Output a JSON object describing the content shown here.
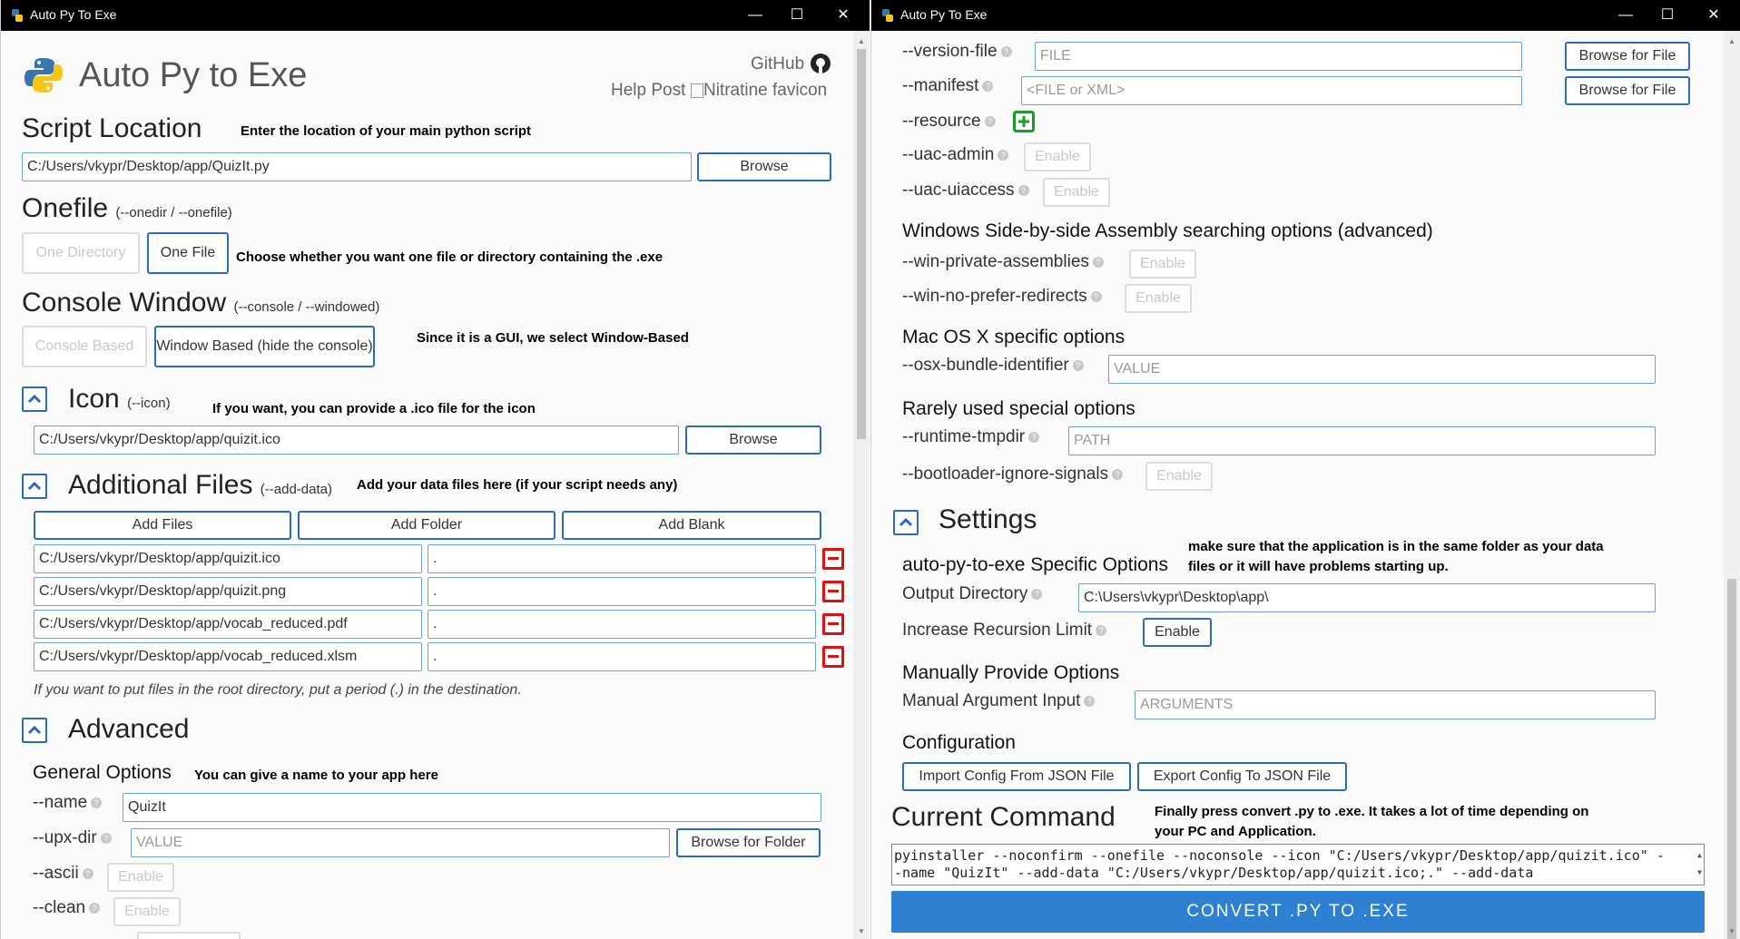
{
  "left_window": {
    "title": "Auto Py To Exe",
    "controls": {
      "minimize": "—",
      "maximize": "☐",
      "close": "✕"
    },
    "app_title": "Auto Py to Exe",
    "links": {
      "github": "GitHub",
      "help_post": "Help Post",
      "favicon_alt": "Nitratine favicon"
    },
    "script_location": {
      "heading": "Script Location",
      "annotation": "Enter the location of your main python script",
      "value": "C:/Users/vkypr/Desktop/app/QuizIt.py",
      "browse_label": "Browse"
    },
    "onefile": {
      "heading": "Onefile",
      "sub": "(--onedir / --onefile)",
      "one_directory": "One Directory",
      "one_file": "One File",
      "annotation": "Choose whether you want one file or directory containing the .exe"
    },
    "console": {
      "heading": "Console Window",
      "sub": "(--console / --windowed)",
      "console_based": "Console Based",
      "window_based": "Window Based (hide the console)",
      "annotation": "Since it is a GUI, we select Window-Based"
    },
    "icon": {
      "heading": "Icon",
      "sub": "(--icon)",
      "annotation": "If you want, you can provide a .ico file for the icon",
      "value": "C:/Users/vkypr/Desktop/app/quizit.ico",
      "browse_label": "Browse"
    },
    "additional_files": {
      "heading": "Additional Files",
      "sub": "(--add-data)",
      "annotation": "Add your data files here (if your script needs any)",
      "add_files": "Add Files",
      "add_folder": "Add Folder",
      "add_blank": "Add Blank",
      "rows": [
        {
          "src": "C:/Users/vkypr/Desktop/app/quizit.ico",
          "dest": "."
        },
        {
          "src": "C:/Users/vkypr/Desktop/app/quizit.png",
          "dest": "."
        },
        {
          "src": "C:/Users/vkypr/Desktop/app/vocab_reduced.pdf",
          "dest": "."
        },
        {
          "src": "C:/Users/vkypr/Desktop/app/vocab_reduced.xlsm",
          "dest": "."
        }
      ],
      "note": "If you want to put files in the root directory, put a period (.) in the destination."
    },
    "advanced": {
      "heading": "Advanced",
      "general_options": "General Options",
      "annotation": "You can give a name to your app here",
      "name_label": "--name",
      "name_value": "QuizIt",
      "upx_label": "--upx-dir",
      "upx_placeholder": "VALUE",
      "browse_folder": "Browse for Folder",
      "ascii_label": "--ascii",
      "clean_label": "--clean",
      "enable": "Enable"
    }
  },
  "right_window": {
    "title": "Auto Py To Exe",
    "controls": {
      "minimize": "—",
      "maximize": "☐",
      "close": "✕"
    },
    "version_file": {
      "label": "--version-file",
      "placeholder": "FILE",
      "browse": "Browse for File"
    },
    "manifest": {
      "label": "--manifest",
      "placeholder": "<FILE or XML>",
      "browse": "Browse for File"
    },
    "resource_label": "--resource",
    "uac_admin_label": "--uac-admin",
    "uac_uiaccess_label": "--uac-uiaccess",
    "enable": "Enable",
    "sxs_heading": "Windows Side-by-side Assembly searching options (advanced)",
    "win_private_label": "--win-private-assemblies",
    "win_no_prefer_label": "--win-no-prefer-redirects",
    "mac_heading": "Mac OS X specific options",
    "osx_label": "--osx-bundle-identifier",
    "osx_placeholder": "VALUE",
    "rare_heading": "Rarely used special options",
    "runtime_label": "--runtime-tmpdir",
    "runtime_placeholder": "PATH",
    "bootloader_label": "--bootloader-ignore-signals",
    "settings": {
      "heading": "Settings",
      "specific": "auto-py-to-exe Specific Options",
      "annotation": "make sure that the application is in the same folder as your data files or it will have problems starting up.",
      "output_label": "Output Directory",
      "output_value": "C:\\Users\\vkypr\\Desktop\\app\\",
      "recursion_label": "Increase Recursion Limit",
      "recursion_btn": "Enable",
      "manual_heading": "Manually Provide Options",
      "manual_label": "Manual Argument Input",
      "manual_placeholder": "ARGUMENTS",
      "config_heading": "Configuration",
      "import_btn": "Import Config From JSON File",
      "export_btn": "Export Config To JSON File"
    },
    "current_command": {
      "heading": "Current Command",
      "annotation": "Finally press convert .py to .exe. It takes a lot of time depending on your PC and Application.",
      "line1": "pyinstaller --noconfirm --onefile --noconsole --icon \"C:/Users/vkypr/Desktop/app/quizit.ico\" -",
      "line2": "-name \"QuizIt\" --add-data \"C:/Users/vkypr/Desktop/app/quizit.ico;.\" --add-data"
    },
    "convert_label": "CONVERT .PY TO .EXE"
  },
  "colors": {
    "accent": "#2b6bbd",
    "convert_bg": "#2f7fd3",
    "remove": "#e01010",
    "add": "#1a9b2a",
    "titlebar": "#000000"
  }
}
